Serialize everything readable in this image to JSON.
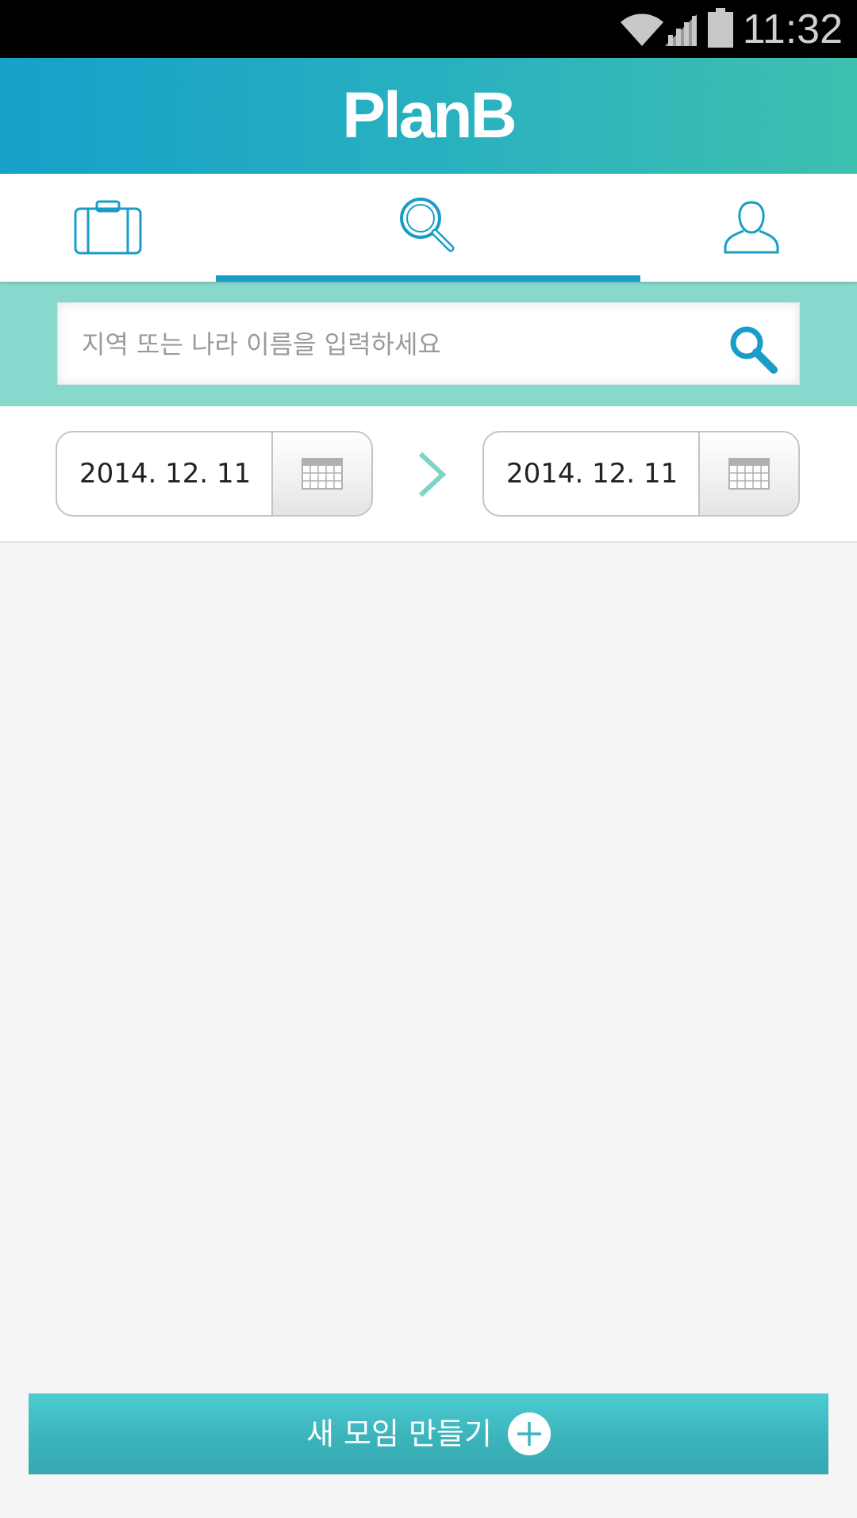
{
  "status_bar": {
    "time": "11:32",
    "icons": [
      "wifi-icon",
      "signal-icon",
      "battery-icon"
    ]
  },
  "header": {
    "logo": "PlanB"
  },
  "tabs": [
    {
      "name": "trips",
      "icon": "suitcase-icon",
      "active": false
    },
    {
      "name": "search",
      "icon": "search-icon",
      "active": true
    },
    {
      "name": "profile",
      "icon": "person-icon",
      "active": false
    }
  ],
  "search": {
    "placeholder": "지역 또는 나라 이름을 입력하세요",
    "value": "",
    "icon": "search-icon"
  },
  "date_range": {
    "start": "2014. 12. 11",
    "end": "2014. 12. 11",
    "separator_icon": "chevron-right-icon",
    "calendar_icon": "calendar-icon"
  },
  "create_button": {
    "label": "새 모임 만들기",
    "icon": "plus-circle-icon"
  },
  "colors": {
    "header_gradient": [
      "#17a0c9",
      "#3ec0b0"
    ],
    "accent": "#1a9cc9",
    "search_band": "#87d8cd",
    "button": "#3db5bd",
    "arrow": "#7fd4c8"
  }
}
